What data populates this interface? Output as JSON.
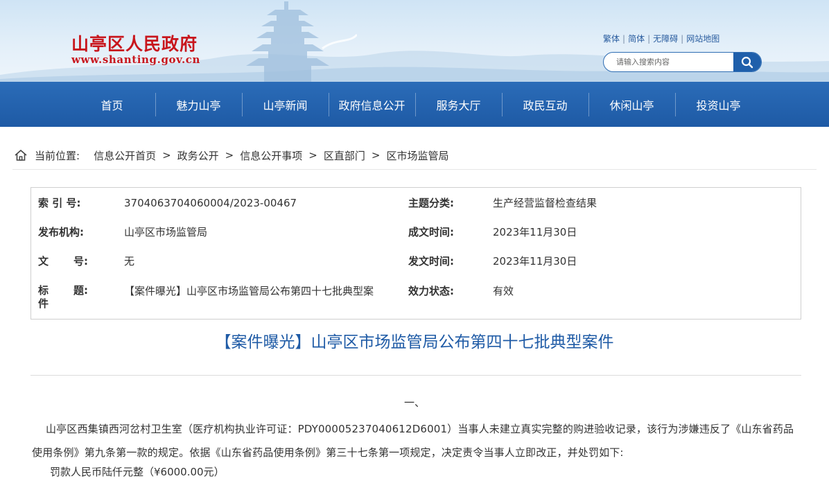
{
  "header": {
    "site_name": "山亭区人民政府",
    "site_url": "www.shanting.gov.cn",
    "top_links": [
      "繁体",
      "简体",
      "无障碍",
      "网站地图"
    ],
    "search": {
      "placeholder": "请输入搜索内容"
    }
  },
  "nav": {
    "items": [
      "首页",
      "魅力山亭",
      "山亭新闻",
      "政府信息公开",
      "服务大厅",
      "政民互动",
      "休闲山亭",
      "投资山亭"
    ]
  },
  "breadcrumb": {
    "label": "当前位置:",
    "items": [
      "信息公开首页",
      "政务公开",
      "信息公开事项",
      "区直部门",
      "区市场监管局"
    ],
    "separator": ">"
  },
  "meta": {
    "index_label": "索 引 号:",
    "index_value": "3704063704060004/2023-00467",
    "topic_label": "主题分类:",
    "topic_value": "生产经营监督检查结果",
    "publisher_label": "发布机构:",
    "publisher_value": "山亭区市场监管局",
    "created_label": "成文时间:",
    "created_value": "2023年11月30日",
    "docno_label_a": "文",
    "docno_label_b": "号:",
    "docno_value": "无",
    "issued_label": "发文时间:",
    "issued_value": "2023年11月30日",
    "title_label_a": "标",
    "title_label_b": "题:",
    "title_label_c": "件",
    "title_value": "【案件曝光】山亭区市场监管局公布第四十七批典型案",
    "status_label": "效力状态:",
    "status_value": "有效"
  },
  "article": {
    "title": "【案件曝光】山亭区市场监管局公布第四十七批典型案件",
    "section_num": "一、",
    "paragraph": "山亭区西集镇西河岔村卫生室（医疗机构执业许可证：PDY00005237040612D6001）当事人未建立真实完整的购进验收记录，该行为涉嫌违反了《山东省药品使用条例》第九条第一款的规定。依据《山东省药品使用条例》第三十七条第一项规定，决定责令当事人立即改正，并处罚如下:",
    "fine": "罚款人民币陆仟元整（¥6000.00元）"
  },
  "colors": {
    "brand_red": "#c8161d",
    "nav_blue": "#1e5aa5",
    "title_blue": "#1f5ba6"
  }
}
